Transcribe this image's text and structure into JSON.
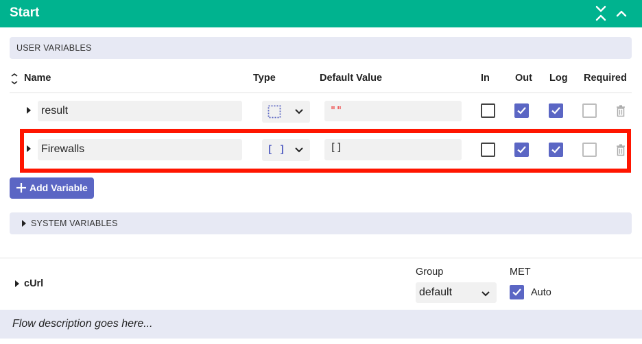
{
  "header": {
    "title": "Start",
    "colors": {
      "bar": "#00b38f",
      "accent": "#5b66c4",
      "highlight": "#ff1500"
    },
    "icons": [
      "collapse-all-icon",
      "chevron-up-icon"
    ]
  },
  "user_variables": {
    "label": "USER VARIABLES",
    "columns": {
      "name": "Name",
      "type": "Type",
      "default": "Default Value",
      "in": "In",
      "out": "Out",
      "log": "Log",
      "required": "Required"
    },
    "rows": [
      {
        "name": "result",
        "type_icon": "string-type-icon",
        "default": "\"\"",
        "in": false,
        "out": true,
        "log": true,
        "required": false
      },
      {
        "name": "Firewalls",
        "type_icon": "array-type-icon",
        "type_glyph": "[ ]",
        "default": "[]",
        "in": false,
        "out": true,
        "log": true,
        "required": false,
        "highlighted": true
      }
    ],
    "add_button": "Add Variable"
  },
  "system_variables": {
    "label": "SYSTEM VARIABLES"
  },
  "step": {
    "name": "cUrl",
    "group_label": "Group",
    "group_value": "default",
    "met_label": "MET",
    "auto_label": "Auto",
    "auto": true
  },
  "description": {
    "placeholder": "Flow description goes here..."
  }
}
